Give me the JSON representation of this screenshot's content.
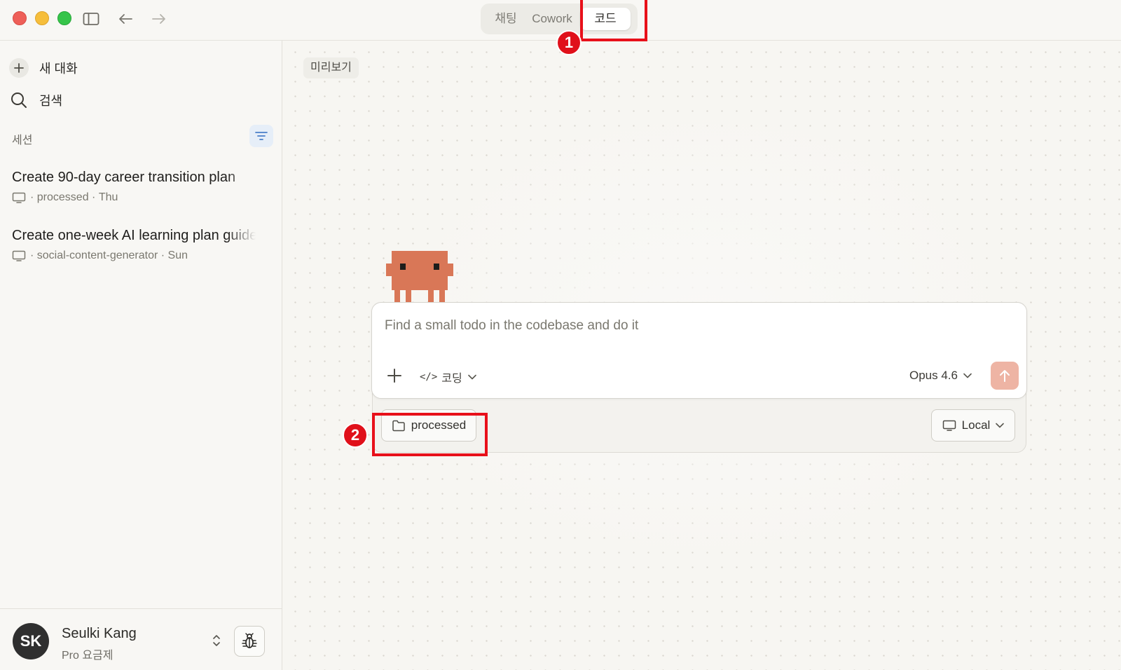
{
  "window": {
    "tabs": [
      {
        "label": "채팅",
        "active": false
      },
      {
        "label": "Cowork",
        "active": false
      },
      {
        "label": "코드",
        "active": true
      }
    ]
  },
  "sidebar": {
    "new_chat": "새 대화",
    "search": "검색",
    "section_label": "세션",
    "sessions": [
      {
        "title": "Create 90-day career transition plan",
        "folder": "processed",
        "day": "Thu"
      },
      {
        "title": "Create one-week AI learning plan guide",
        "folder": "social-content-generator",
        "day": "Sun"
      }
    ],
    "user": {
      "initials": "SK",
      "name": "Seulki Kang",
      "plan": "Pro 요금제"
    }
  },
  "main": {
    "preview_chip": "미리보기",
    "composer": {
      "placeholder": "Find a small todo in the codebase and do it",
      "mode_label": "코딩",
      "model_label": "Opus 4.6"
    },
    "folder_chip": "processed",
    "env_chip": "Local"
  },
  "annotations": {
    "first": "1",
    "second": "2"
  },
  "colors": {
    "accent_send": "#eeb4a4",
    "mascot": "#d97757",
    "annotation": "#e8101a"
  }
}
